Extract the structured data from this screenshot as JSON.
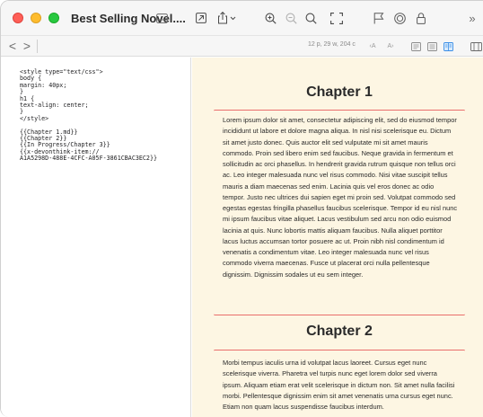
{
  "window": {
    "title": "Best Selling Novel...."
  },
  "pathbar": {
    "back": "<",
    "forward": ">",
    "stats": "12 p, 29 w, 204 c",
    "font_smaller": "‹A",
    "font_larger": "A›"
  },
  "source": {
    "text": "<style type=\"text/css\">\nbody {\nmargin: 40px;\n}\nh1 {\ntext-align: center;\n}\n</style>\n\n{{Chapter 1.md}}\n{{Chapter 2}}\n{{In Progress/Chapter 3}}\n{{x-devonthink-item://\nA1A5298D-488E-4CFC-A05F-3861CBAC3EC2}}"
  },
  "preview": {
    "chapters": [
      {
        "heading": "Chapter 1",
        "body": "Lorem ipsum dolor sit amet, consectetur adipiscing elit, sed do eiusmod tempor incididunt ut labore et dolore magna aliqua. In nisl nisi scelerisque eu. Dictum sit amet justo donec. Quis auctor elit sed vulputate mi sit amet mauris commodo. Proin sed libero enim sed faucibus. Neque gravida in fermentum et sollicitudin ac orci phasellus. In hendrerit gravida rutrum quisque non tellus orci ac. Leo integer malesuada nunc vel risus commodo. Nisi vitae suscipit tellus mauris a diam maecenas sed enim. Lacinia quis vel eros donec ac odio tempor. Justo nec ultrices dui sapien eget mi proin sed. Volutpat commodo sed egestas egestas fringilla phasellus faucibus scelerisque. Tempor id eu nisl nunc mi ipsum faucibus vitae aliquet. Lacus vestibulum sed arcu non odio euismod lacinia at quis. Nunc lobortis mattis aliquam faucibus. Nulla aliquet porttitor lacus luctus accumsan tortor posuere ac ut. Proin nibh nisl condimentum id venenatis a condimentum vitae. Leo integer malesuada nunc vel risus commodo viverra maecenas. Fusce ut placerat orci nulla pellentesque dignissim. Dignissim sodales ut eu sem integer."
      },
      {
        "heading": "Chapter 2",
        "body": "Morbi tempus iaculis urna id volutpat lacus laoreet. Cursus eget nunc scelerisque viverra. Pharetra vel turpis nunc eget lorem dolor sed viverra ipsum. Aliquam etiam erat velit scelerisque in dictum non. Sit amet nulla facilisi morbi. Pellentesque dignissim enim sit amet venenatis urna cursus eget nunc. Etiam non quam lacus suspendisse faucibus interdum."
      }
    ]
  },
  "colors": {
    "preview_background": "#fdf6e3",
    "heading_rule": "#e86060",
    "close": "#fe5f57",
    "minimize": "#febc2e",
    "maximize": "#28c840"
  },
  "icons": {
    "toolbar": [
      "sidebar-icon",
      "open-external-icon",
      "share-icon",
      "zoom-in-icon",
      "zoom-out-icon",
      "search-icon",
      "capture-frame-icon",
      "flag-icon",
      "annotation-icon",
      "lock-icon",
      "more-icon"
    ],
    "pathbar": [
      "font-smaller-icon",
      "font-larger-icon",
      "view-source-icon",
      "view-split-icon",
      "view-preview-icon",
      "inspector-icon"
    ]
  }
}
